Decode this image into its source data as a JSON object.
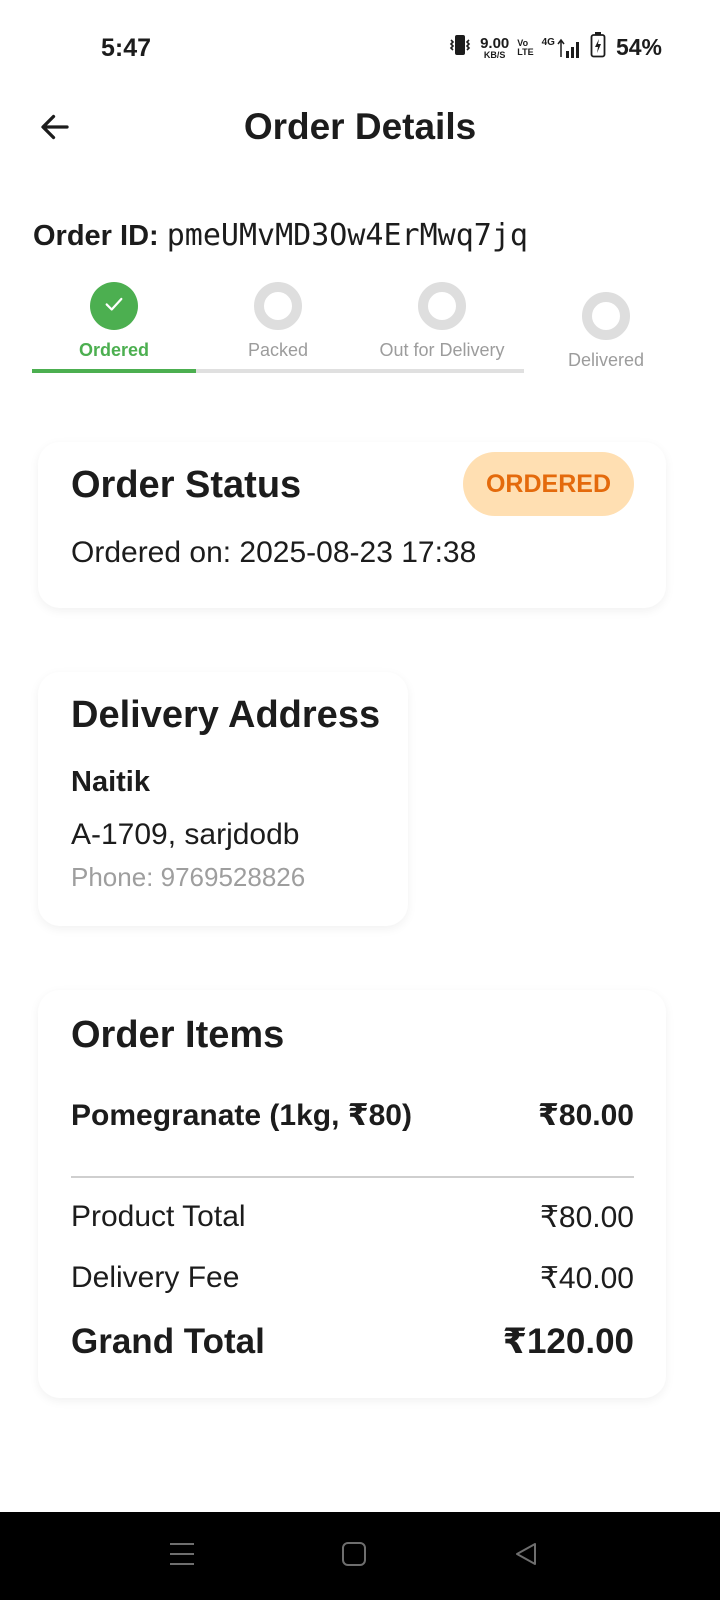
{
  "status_bar": {
    "time": "5:47",
    "net_speed_value": "9.00",
    "net_speed_unit": "KB/S",
    "volte_top": "Vo",
    "volte_bottom": "LTE",
    "network_type": "4G",
    "battery_percent": "54%"
  },
  "header": {
    "title": "Order Details"
  },
  "order": {
    "id_label": "Order ID:",
    "id_value": "pmeUMvMD3Ow4ErMwq7jq"
  },
  "progress": {
    "steps": [
      {
        "label": "Ordered",
        "state": "done"
      },
      {
        "label": "Packed",
        "state": "pending"
      },
      {
        "label": "Out for Delivery",
        "state": "pending"
      },
      {
        "label": "Delivered",
        "state": "pending"
      }
    ],
    "completed_fraction": 0.333
  },
  "status_card": {
    "title": "Order Status",
    "badge": "ORDERED",
    "ordered_on": "Ordered on: 2025-08-23 17:38"
  },
  "address_card": {
    "title": "Delivery Address",
    "name": "Naitik",
    "line": "A-1709, sarjdodb",
    "phone": "Phone: 9769528826"
  },
  "items_card": {
    "title": "Order Items",
    "items": [
      {
        "name": "Pomegranate (1kg, ₹80)",
        "price": "₹80.00"
      }
    ],
    "product_total_label": "Product Total",
    "product_total": "₹80.00",
    "delivery_fee_label": "Delivery Fee",
    "delivery_fee": "₹40.00",
    "grand_total_label": "Grand Total",
    "grand_total": "₹120.00"
  },
  "colors": {
    "accent_green": "#4caf50",
    "badge_bg": "#ffdfb2",
    "badge_text": "#e46a0c",
    "pending_gray": "#dedede"
  },
  "icons": {
    "back": "arrow-left-icon",
    "check": "check-icon",
    "nav_menu": "menu-icon",
    "nav_home": "square-icon",
    "nav_back": "triangle-back-icon"
  }
}
